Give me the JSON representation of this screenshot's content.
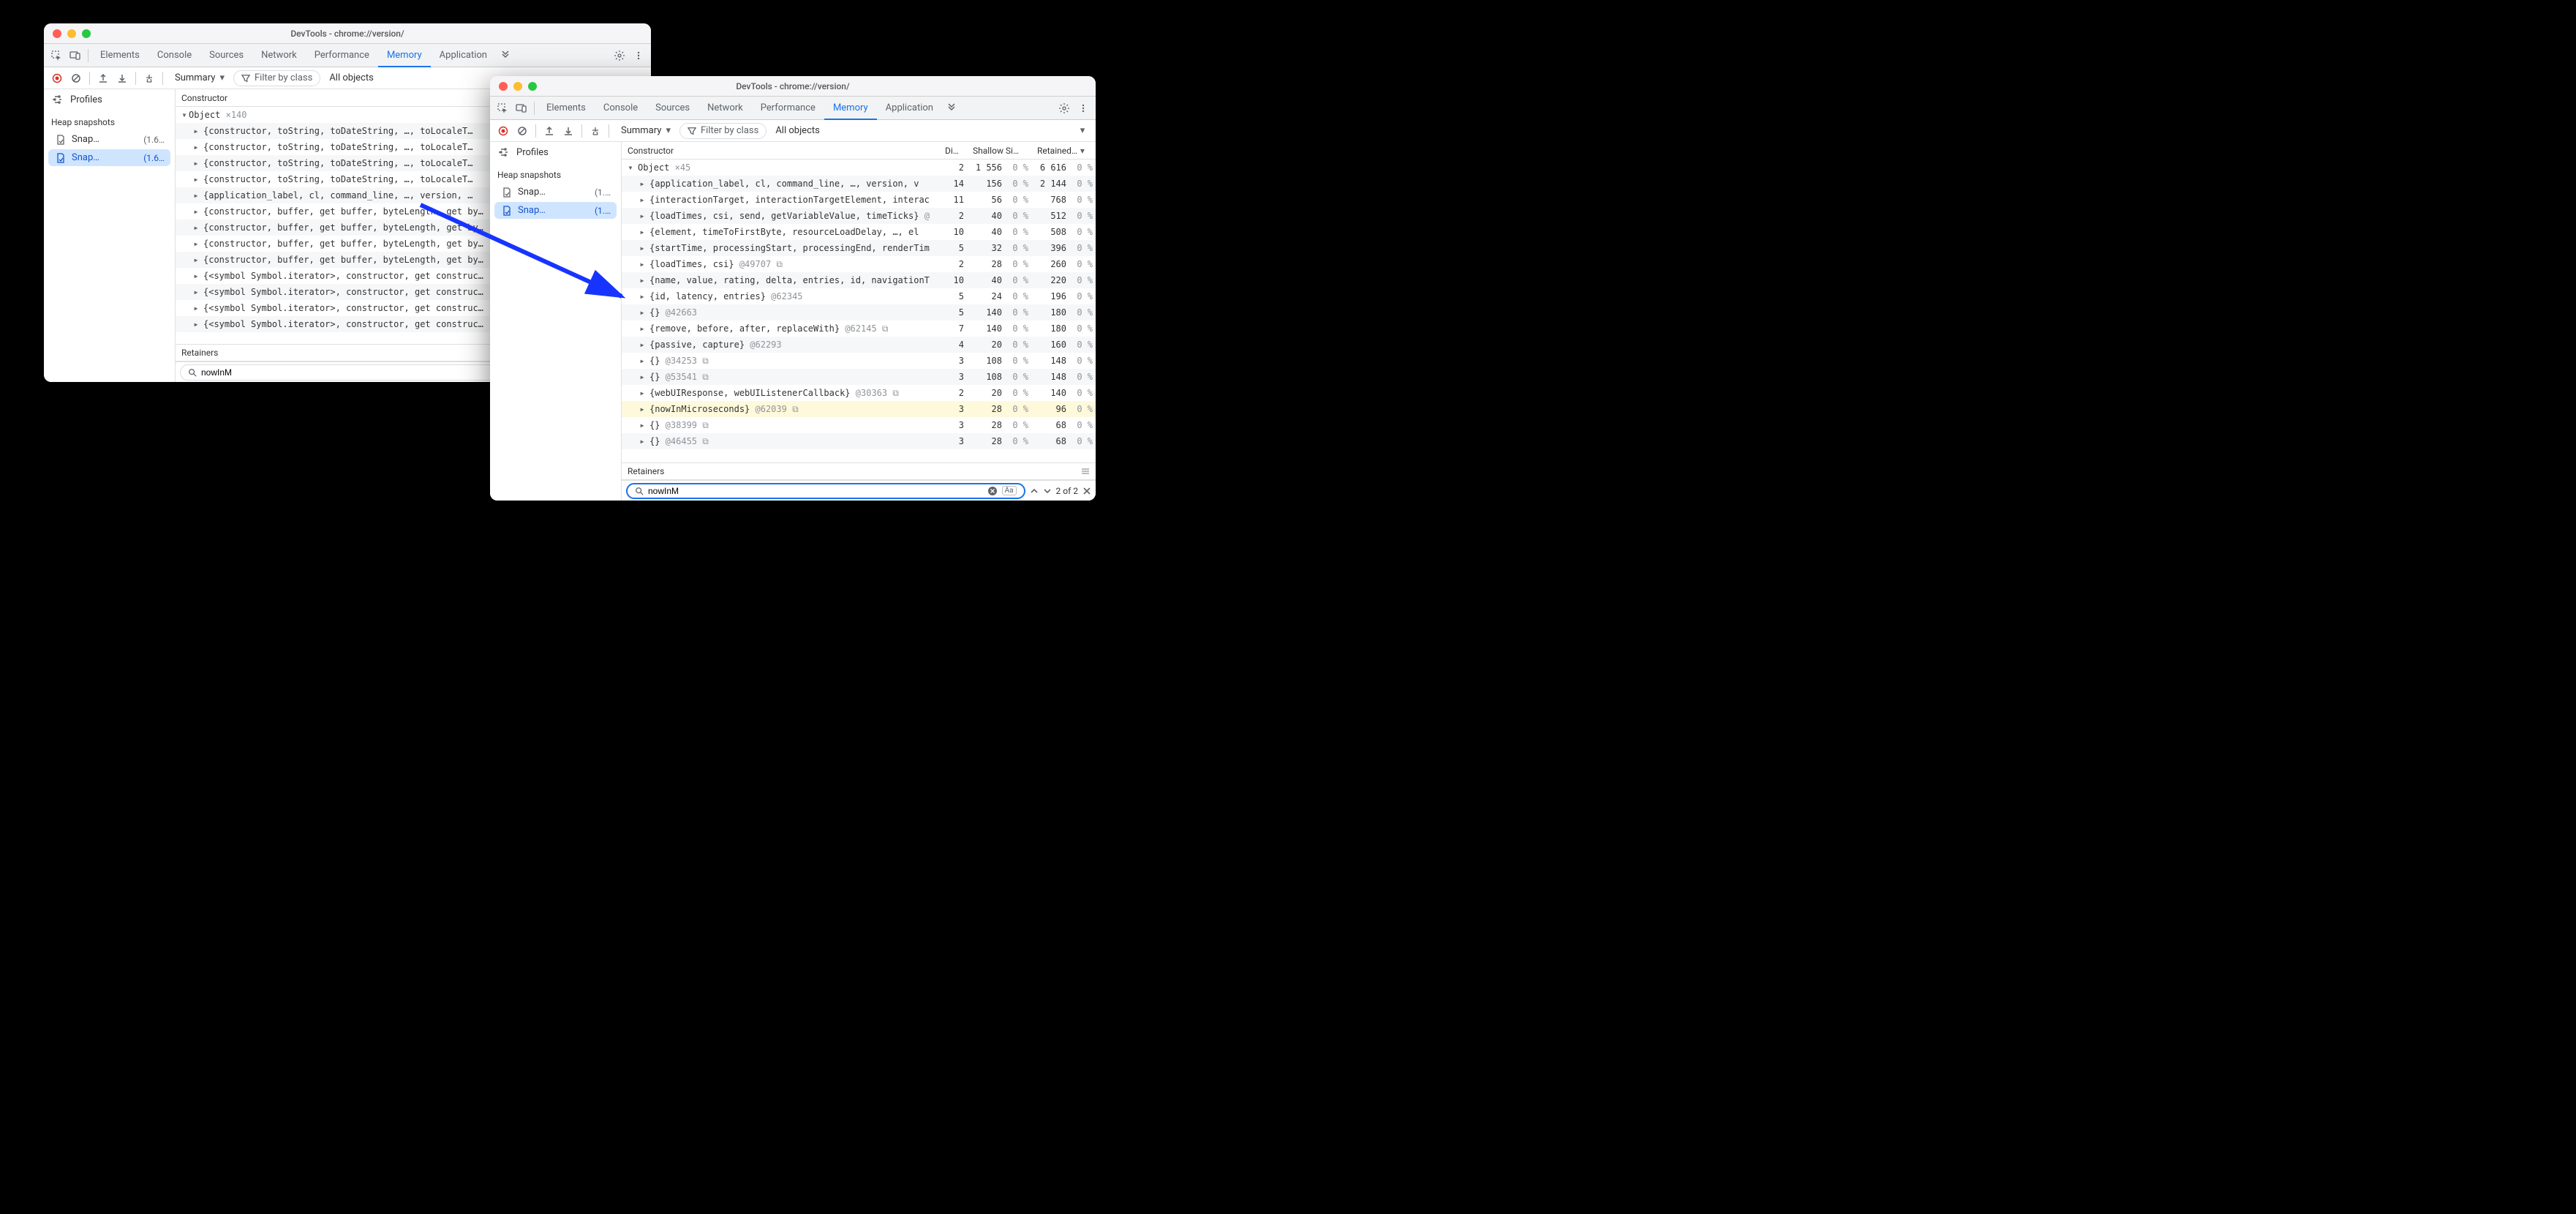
{
  "window1": {
    "title": "DevTools - chrome://version/",
    "tabs": [
      "Elements",
      "Console",
      "Sources",
      "Network",
      "Performance",
      "Memory",
      "Application"
    ],
    "active_tab": "Memory",
    "toolbar": {
      "select_mode": "Summary",
      "filter_label": "Filter by class",
      "objects_label": "All objects"
    },
    "sidebar": {
      "profiles_label": "Profiles",
      "heap_heading": "Heap snapshots",
      "items": [
        {
          "label": "Snap…",
          "size": "(1.6…"
        },
        {
          "label": "Snap…",
          "size": "(1.6…"
        }
      ]
    },
    "constructor_header": "Constructor",
    "root": {
      "label": "Object",
      "count": "×140"
    },
    "rows": [
      "{constructor, toString, toDateString, …, toLocaleT…",
      "{constructor, toString, toDateString, …, toLocaleT…",
      "{constructor, toString, toDateString, …, toLocaleT…",
      "{constructor, toString, toDateString, …, toLocaleT…",
      "{application_label, cl, command_line, …, version, …",
      "{constructor, buffer, get buffer, byteLength, get by…",
      "{constructor, buffer, get buffer, byteLength, get by…",
      "{constructor, buffer, get buffer, byteLength, get by…",
      "{constructor, buffer, get buffer, byteLength, get by…",
      "{<symbol Symbol.iterator>, constructor, get construc…",
      "{<symbol Symbol.iterator>, constructor, get construc…",
      "{<symbol Symbol.iterator>, constructor, get construc…",
      "{<symbol Symbol.iterator>, constructor, get construc…"
    ],
    "retainers_label": "Retainers",
    "search_value": "nowInM"
  },
  "window2": {
    "title": "DevTools - chrome://version/",
    "tabs": [
      "Elements",
      "Console",
      "Sources",
      "Network",
      "Performance",
      "Memory",
      "Application"
    ],
    "active_tab": "Memory",
    "toolbar": {
      "select_mode": "Summary",
      "filter_label": "Filter by class",
      "objects_label": "All objects"
    },
    "sidebar": {
      "profiles_label": "Profiles",
      "heap_heading": "Heap snapshots",
      "items": [
        {
          "label": "Snap…",
          "size": "(1.…"
        },
        {
          "label": "Snap…",
          "size": "(1.…"
        }
      ]
    },
    "columns": {
      "constructor": "Constructor",
      "distance": "Di…",
      "shallow": "Shallow Si…",
      "retained": "Retained…"
    },
    "root": {
      "label": "Object",
      "count": "×45",
      "dist": "2",
      "shallow": "1 556",
      "shallow_pct": "0 %",
      "retained": "6 616",
      "retained_pct": "0 %"
    },
    "rows": [
      {
        "text": "{application_label, cl, command_line, …, version, v",
        "suffix": "",
        "dist": "14",
        "sh": "156",
        "shp": "0 %",
        "re": "2 144",
        "rep": "0 %"
      },
      {
        "text": "{interactionTarget, interactionTargetElement, interac",
        "suffix": "",
        "dist": "11",
        "sh": "56",
        "shp": "0 %",
        "re": "768",
        "rep": "0 %"
      },
      {
        "text": "{loadTimes, csi, send, getVariableValue, timeTicks}",
        "suffix": " @",
        "dist": "2",
        "sh": "40",
        "shp": "0 %",
        "re": "512",
        "rep": "0 %"
      },
      {
        "text": "{element, timeToFirstByte, resourceLoadDelay, …, el",
        "suffix": "",
        "dist": "10",
        "sh": "40",
        "shp": "0 %",
        "re": "508",
        "rep": "0 %"
      },
      {
        "text": "{startTime, processingStart, processingEnd, renderTim",
        "suffix": "",
        "dist": "5",
        "sh": "32",
        "shp": "0 %",
        "re": "396",
        "rep": "0 %"
      },
      {
        "text": "{loadTimes, csi}",
        "suffix": " @49707 ⧉",
        "dist": "2",
        "sh": "28",
        "shp": "0 %",
        "re": "260",
        "rep": "0 %"
      },
      {
        "text": "{name, value, rating, delta, entries, id, navigationT",
        "suffix": "",
        "dist": "10",
        "sh": "40",
        "shp": "0 %",
        "re": "220",
        "rep": "0 %"
      },
      {
        "text": "{id, latency, entries}",
        "suffix": " @62345",
        "dist": "5",
        "sh": "24",
        "shp": "0 %",
        "re": "196",
        "rep": "0 %"
      },
      {
        "text": "{}",
        "suffix": " @42663",
        "dist": "5",
        "sh": "140",
        "shp": "0 %",
        "re": "180",
        "rep": "0 %"
      },
      {
        "text": "{remove, before, after, replaceWith}",
        "suffix": " @62145 ⧉",
        "dist": "7",
        "sh": "140",
        "shp": "0 %",
        "re": "180",
        "rep": "0 %"
      },
      {
        "text": "{passive, capture}",
        "suffix": " @62293",
        "dist": "4",
        "sh": "20",
        "shp": "0 %",
        "re": "160",
        "rep": "0 %"
      },
      {
        "text": "{}",
        "suffix": " @34253 ⧉",
        "dist": "3",
        "sh": "108",
        "shp": "0 %",
        "re": "148",
        "rep": "0 %"
      },
      {
        "text": "{}",
        "suffix": " @53541 ⧉",
        "dist": "3",
        "sh": "108",
        "shp": "0 %",
        "re": "148",
        "rep": "0 %"
      },
      {
        "text": "{webUIResponse, webUIListenerCallback}",
        "suffix": " @30363 ⧉",
        "dist": "2",
        "sh": "20",
        "shp": "0 %",
        "re": "140",
        "rep": "0 %"
      },
      {
        "text": "{nowInMicroseconds}",
        "suffix": " @62039 ⧉",
        "dist": "3",
        "sh": "28",
        "shp": "0 %",
        "re": "96",
        "rep": "0 %",
        "highlight": true
      },
      {
        "text": "{}",
        "suffix": " @38399 ⧉",
        "dist": "3",
        "sh": "28",
        "shp": "0 %",
        "re": "68",
        "rep": "0 %"
      },
      {
        "text": "{}",
        "suffix": " @46455 ⧉",
        "dist": "3",
        "sh": "28",
        "shp": "0 %",
        "re": "68",
        "rep": "0 %"
      }
    ],
    "retainers_label": "Retainers",
    "search_value": "nowInM",
    "match_count": "2 of 2",
    "aa_label": "Aa"
  }
}
